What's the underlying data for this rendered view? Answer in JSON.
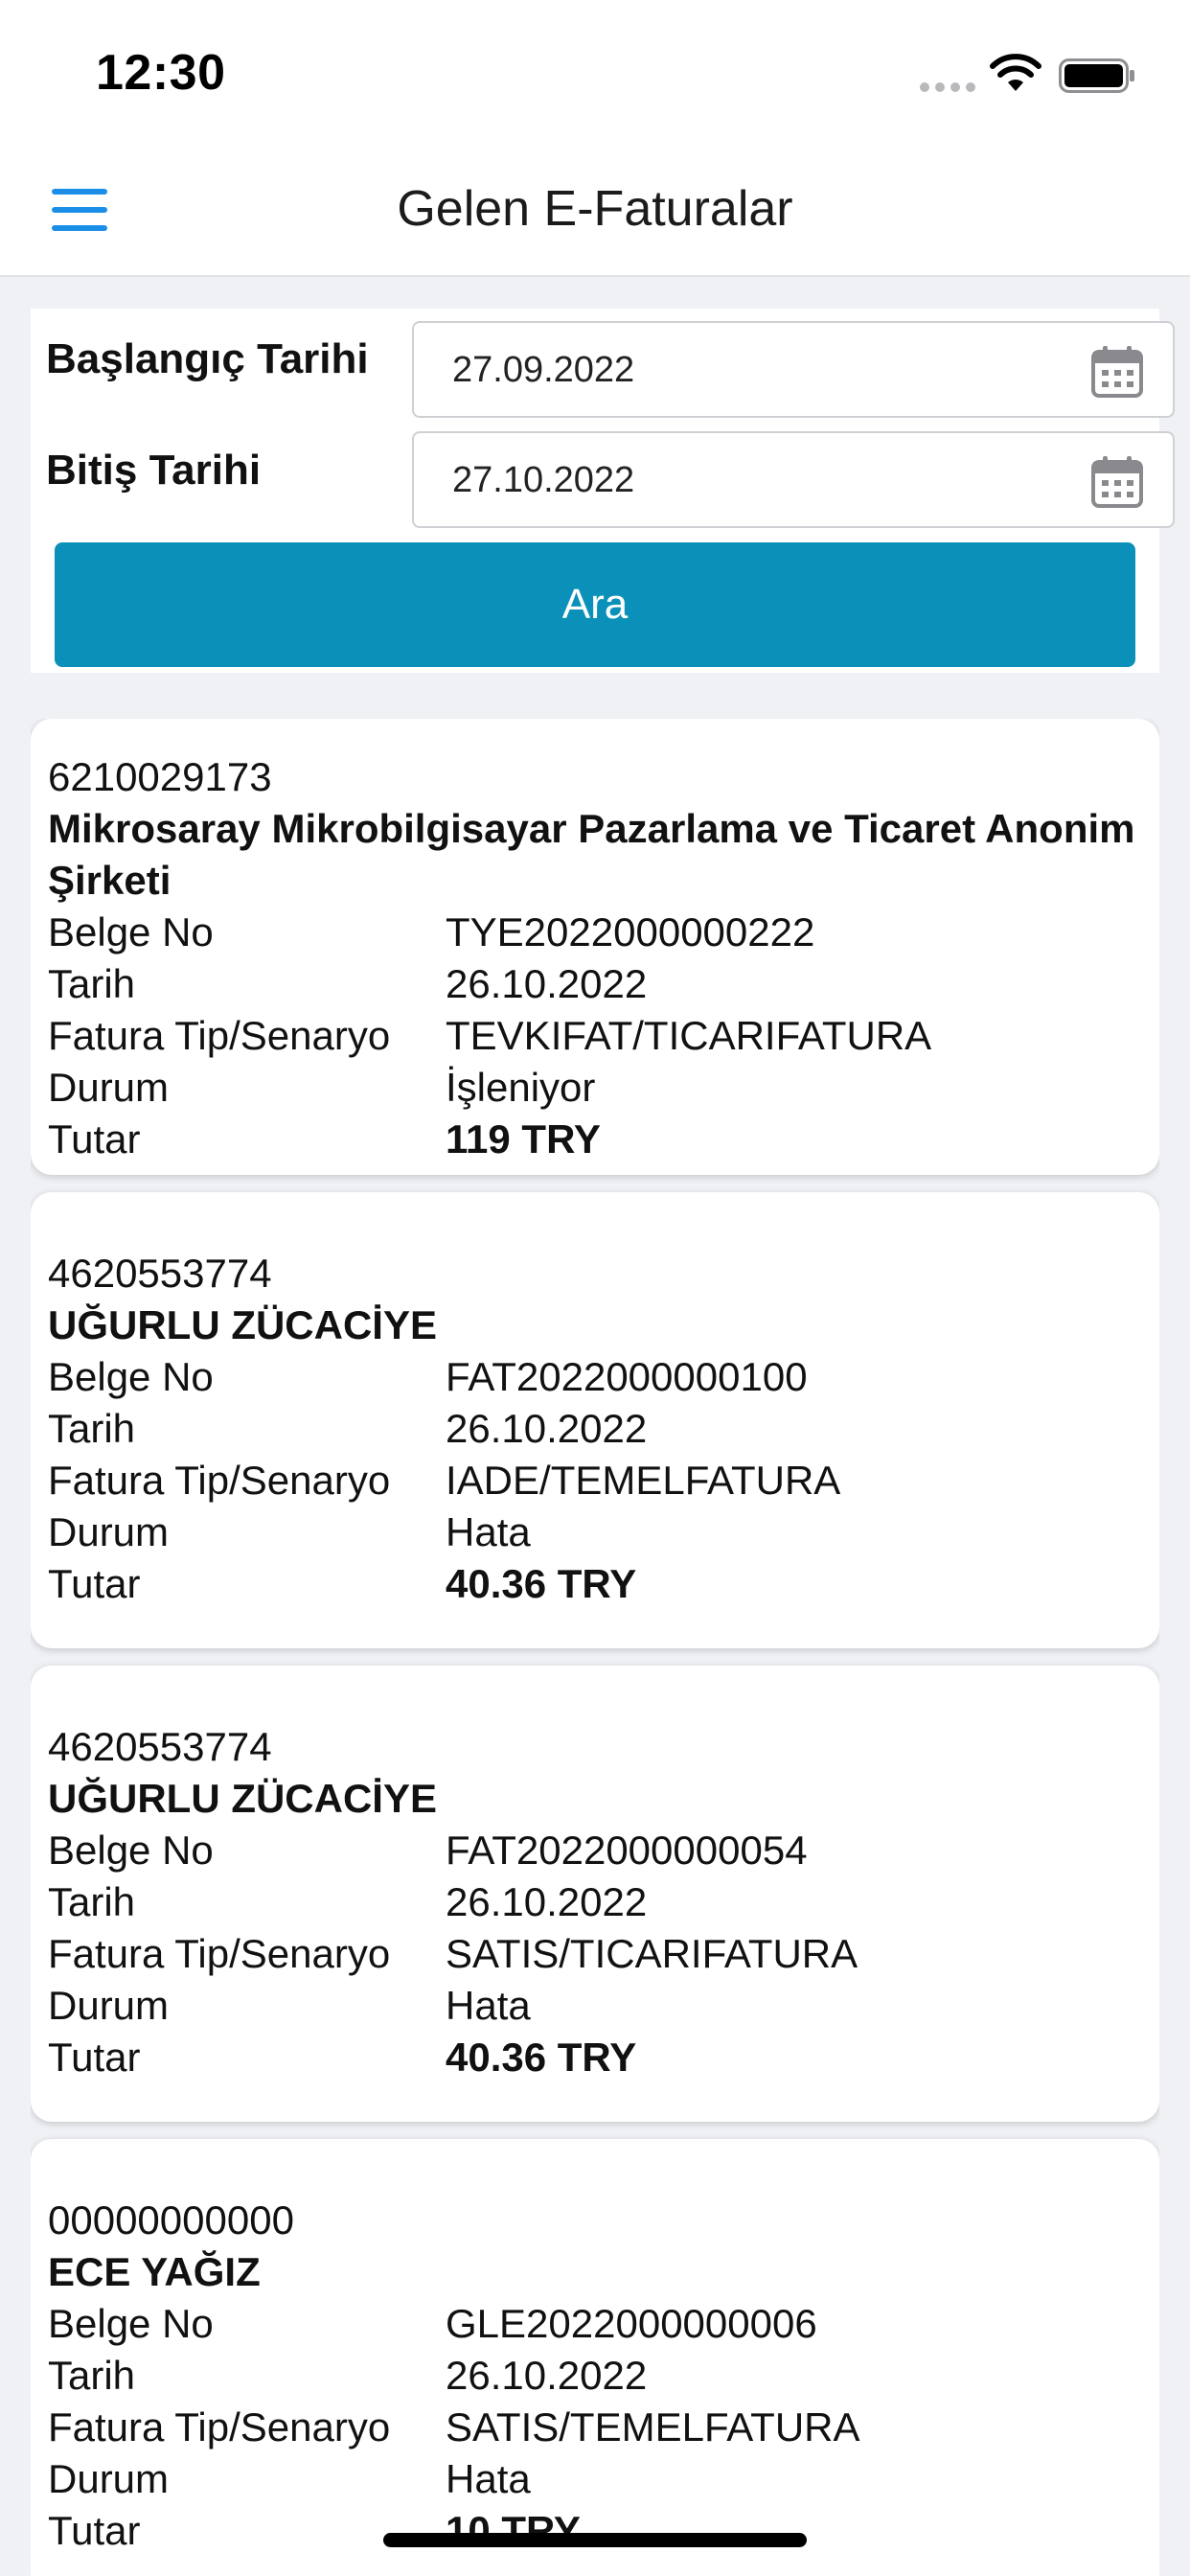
{
  "status_bar": {
    "time": "12:30"
  },
  "nav": {
    "title": "Gelen E-Faturalar"
  },
  "filter": {
    "start_label": "Başlangıç Tarihi",
    "start_value": "27.09.2022",
    "end_label": "Bitiş Tarihi",
    "end_value": "27.10.2022",
    "search_label": "Ara"
  },
  "colors": {
    "accent": "#1b8ee8",
    "button": "#0b91b9",
    "background": "#f0f1f5"
  },
  "invoices": [
    {
      "tax_no": "6210029173",
      "company": "Mikrosaray Mikrobilgisayar Pazarlama ve Ticaret Anonim Şirketi",
      "doc_label": "Belge No",
      "doc_no": "TYE2022000000222",
      "date_label": "Tarih",
      "date": "26.10.2022",
      "type_label": "Fatura Tip/Senaryo",
      "type": "TEVKIFAT/TICARIFATURA",
      "status_label": "Durum",
      "status": "İşleniyor",
      "amount_label": "Tutar",
      "amount": "119 TRY"
    },
    {
      "tax_no": "4620553774",
      "company": "UĞURLU ZÜCACİYE",
      "doc_label": "Belge No",
      "doc_no": "FAT2022000000100",
      "date_label": "Tarih",
      "date": "26.10.2022",
      "type_label": "Fatura Tip/Senaryo",
      "type": "IADE/TEMELFATURA",
      "status_label": "Durum",
      "status": "Hata",
      "amount_label": "Tutar",
      "amount": "40.36 TRY"
    },
    {
      "tax_no": "4620553774",
      "company": "UĞURLU ZÜCACİYE",
      "doc_label": "Belge No",
      "doc_no": "FAT2022000000054",
      "date_label": "Tarih",
      "date": "26.10.2022",
      "type_label": "Fatura Tip/Senaryo",
      "type": "SATIS/TICARIFATURA",
      "status_label": "Durum",
      "status": "Hata",
      "amount_label": "Tutar",
      "amount": "40.36 TRY"
    },
    {
      "tax_no": "00000000000",
      "company": "ECE YAĞIZ",
      "doc_label": "Belge No",
      "doc_no": "GLE2022000000006",
      "date_label": "Tarih",
      "date": "26.10.2022",
      "type_label": "Fatura Tip/Senaryo",
      "type": "SATIS/TEMELFATURA",
      "status_label": "Durum",
      "status": "Hata",
      "amount_label": "Tutar",
      "amount": "10 TRY"
    }
  ]
}
